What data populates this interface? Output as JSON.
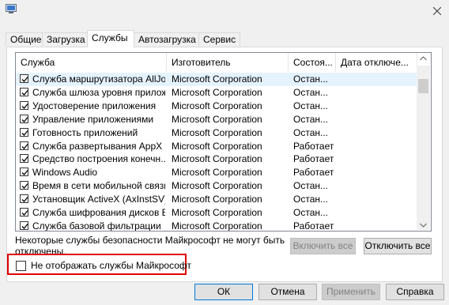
{
  "tabs": [
    {
      "label": "Общие"
    },
    {
      "label": "Загрузка"
    },
    {
      "label": "Службы"
    },
    {
      "label": "Автозагрузка"
    },
    {
      "label": "Сервис"
    }
  ],
  "columns": [
    "Служба",
    "Изготовитель",
    "Состоя...",
    "Дата отключе..."
  ],
  "rows": [
    {
      "name": "Служба маршрутизатора AllJoyn",
      "maker": "Microsoft Corporation",
      "state": "Остан..."
    },
    {
      "name": "Служба шлюза уровня прилож...",
      "maker": "Microsoft Corporation",
      "state": "Остан..."
    },
    {
      "name": "Удостоверение приложения",
      "maker": "Microsoft Corporation",
      "state": "Остан..."
    },
    {
      "name": "Управление приложениями",
      "maker": "Microsoft Corporation",
      "state": "Остан..."
    },
    {
      "name": "Готовность приложений",
      "maker": "Microsoft Corporation",
      "state": "Остан..."
    },
    {
      "name": "Служба развертывания AppX (...",
      "maker": "Microsoft Corporation",
      "state": "Работает"
    },
    {
      "name": "Средство построения конечн...",
      "maker": "Microsoft Corporation",
      "state": "Работает"
    },
    {
      "name": "Windows Audio",
      "maker": "Microsoft Corporation",
      "state": "Работает"
    },
    {
      "name": "Время в сети мобильной связи",
      "maker": "Microsoft Corporation",
      "state": "Остан..."
    },
    {
      "name": "Установщик ActiveX (AxInstSV)",
      "maker": "Microsoft Corporation",
      "state": "Остан..."
    },
    {
      "name": "Служба шифрования дисков Bi...",
      "maker": "Microsoft Corporation",
      "state": "Остан..."
    },
    {
      "name": "Служба базовой фильтрации",
      "maker": "Microsoft Corporation",
      "state": "Работает"
    }
  ],
  "note": "Некоторые службы безопасности Майкрософт не могут быть отключены.",
  "buttons": {
    "enable_all": "Включить все",
    "disable_all": "Отключить все",
    "ok": "ОК",
    "cancel": "Отмена",
    "apply": "Применить",
    "help": "Справка"
  },
  "hide_ms_label": "Не отображать службы Майкрософт",
  "colors": {
    "highlight": "#e00000",
    "accent": "#0078d7"
  },
  "icons": {
    "app": "msconfig-icon",
    "close": "close-icon",
    "check": "checkmark-icon"
  }
}
